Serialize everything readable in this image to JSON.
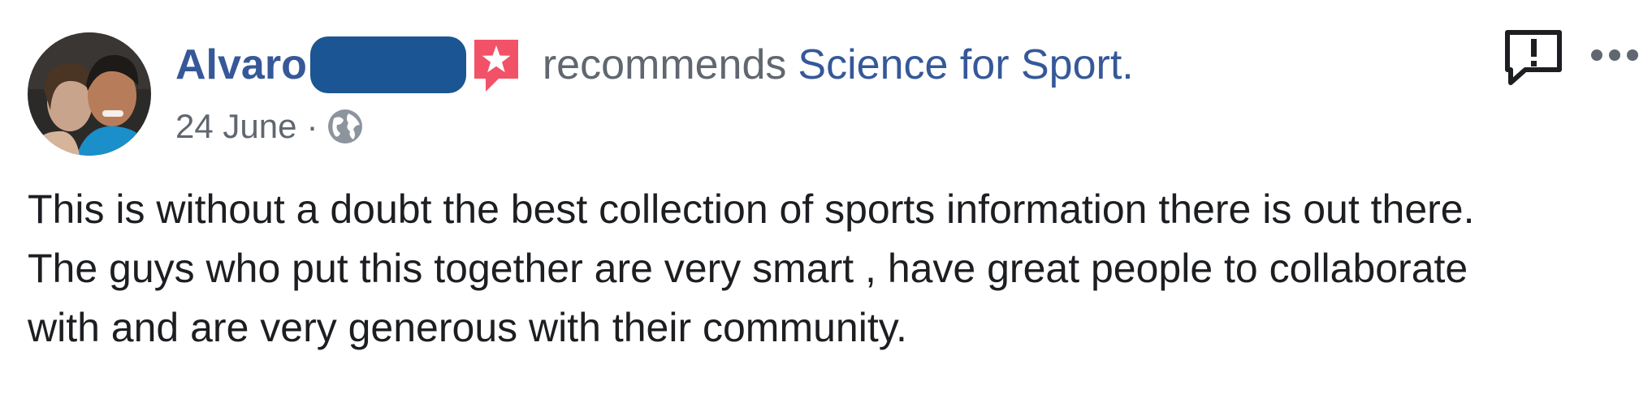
{
  "post": {
    "author_name": "Alvaro",
    "action_text": "recommends",
    "page_name": "Science for Sport",
    "period": ".",
    "date": "24 June",
    "separator": "·",
    "privacy_icon": "globe-icon",
    "badge_icon": "recommendation-star-icon",
    "report_icon": "report-icon",
    "more_icon": "more-options-icon",
    "body_lines": [
      "This is without a doubt the best collection of sports information there is out there.",
      "The guys who put this together are very smart , have great people to collaborate",
      "with and are very generous with their community."
    ]
  },
  "colors": {
    "link_blue": "#365899",
    "meta_grey": "#606770",
    "text_dark": "#1c1e21",
    "redaction_blue": "#1b5593",
    "badge_red": "#f25268"
  }
}
